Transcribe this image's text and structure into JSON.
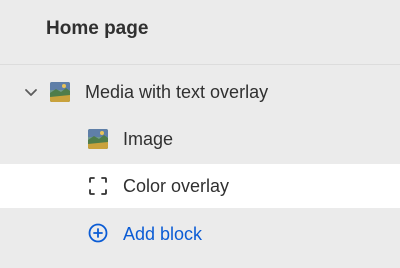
{
  "header": {
    "title": "Home page"
  },
  "section": {
    "label": "Media with text overlay",
    "expand_icon": "chevron-down-icon",
    "thumbnail_icon": "landscape-thumbnail-icon"
  },
  "blocks": [
    {
      "label": "Image",
      "icon": "landscape-thumbnail-icon",
      "selected": false
    },
    {
      "label": "Color overlay",
      "icon": "dashed-square-icon",
      "selected": true
    }
  ],
  "add_block": {
    "label": "Add block",
    "icon": "plus-circle-icon",
    "color": "#0b5cd5"
  },
  "colors": {
    "background": "#ebebeb",
    "selected_row": "#ffffff",
    "text": "#303030",
    "link": "#0b5cd5"
  }
}
